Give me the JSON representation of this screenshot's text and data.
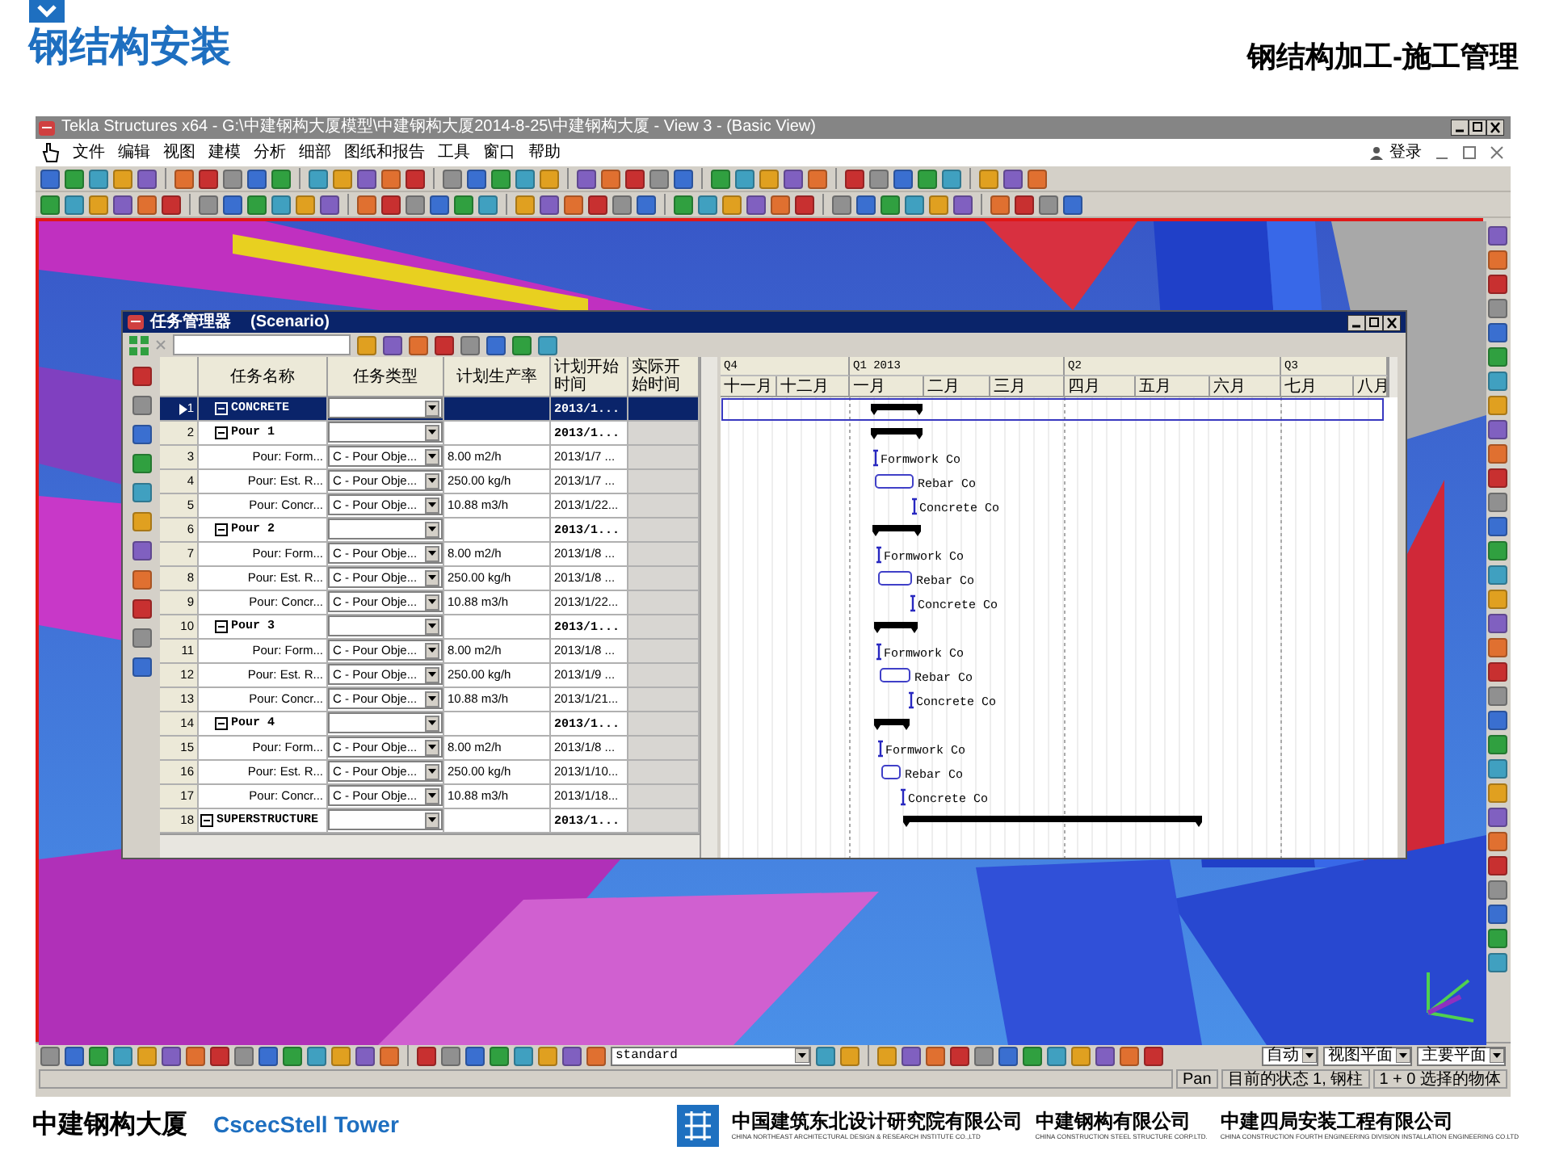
{
  "slide": {
    "title": "钢结构安装",
    "subtitle": "钢结构加工-施工管理"
  },
  "app": {
    "title": "Tekla Structures x64 - G:\\中建钢构大厦模型\\中建钢构大厦2014-8-25\\中建钢构大厦  - View 3 - (Basic View)",
    "menu": [
      "文件",
      "编辑",
      "视图",
      "建模",
      "分析",
      "细部",
      "图纸和报告",
      "工具",
      "窗口",
      "帮助"
    ],
    "login": "登录"
  },
  "task_manager": {
    "title": "任务管理器",
    "subtitle": "(Scenario)",
    "columns": [
      "任务名称",
      "任务类型",
      "计划生产率",
      "计划开始时间",
      "实际开始时间"
    ],
    "rows": [
      {
        "number": "1",
        "kind": "group",
        "name": "CONCRETE",
        "expanded": true,
        "start": "2013/1...",
        "selected": true
      },
      {
        "number": "2",
        "kind": "group",
        "name": "Pour 1",
        "expanded": true,
        "start": "2013/1...",
        "selected": false
      },
      {
        "number": "3",
        "kind": "task",
        "name": "Pour: Form...",
        "type": "C - Pour Obje...",
        "rate": "8.00 m2/h",
        "start": "2013/1/7 ...",
        "gantt_label": "Formwork Co",
        "selected": false
      },
      {
        "number": "4",
        "kind": "task",
        "name": "Pour: Est. R...",
        "type": "C - Pour Obje...",
        "rate": "250.00 kg/h",
        "start": "2013/1/7 ...",
        "gantt_label": "Rebar Co",
        "selected": false
      },
      {
        "number": "5",
        "kind": "task",
        "name": "Pour: Concr...",
        "type": "C - Pour Obje...",
        "rate": "10.88 m3/h",
        "start": "2013/1/22...",
        "gantt_label": "Concrete Co",
        "selected": false
      },
      {
        "number": "6",
        "kind": "group",
        "name": "Pour 2",
        "expanded": true,
        "start": "2013/1...",
        "selected": false
      },
      {
        "number": "7",
        "kind": "task",
        "name": "Pour: Form...",
        "type": "C - Pour Obje...",
        "rate": "8.00 m2/h",
        "start": "2013/1/8 ...",
        "gantt_label": "Formwork Co",
        "selected": false
      },
      {
        "number": "8",
        "kind": "task",
        "name": "Pour: Est. R...",
        "type": "C - Pour Obje...",
        "rate": "250.00 kg/h",
        "start": "2013/1/8 ...",
        "gantt_label": "Rebar Co",
        "selected": false
      },
      {
        "number": "9",
        "kind": "task",
        "name": "Pour: Concr...",
        "type": "C - Pour Obje...",
        "rate": "10.88 m3/h",
        "start": "2013/1/22...",
        "gantt_label": "Concrete Co",
        "selected": false
      },
      {
        "number": "10",
        "kind": "group",
        "name": "Pour 3",
        "expanded": true,
        "start": "2013/1...",
        "selected": false
      },
      {
        "number": "11",
        "kind": "task",
        "name": "Pour: Form...",
        "type": "C - Pour Obje...",
        "rate": "8.00 m2/h",
        "start": "2013/1/8 ...",
        "gantt_label": "Formwork Co",
        "selected": false
      },
      {
        "number": "12",
        "kind": "task",
        "name": "Pour: Est. R...",
        "type": "C - Pour Obje...",
        "rate": "250.00 kg/h",
        "start": "2013/1/9 ...",
        "gantt_label": "Rebar Co",
        "selected": false
      },
      {
        "number": "13",
        "kind": "task",
        "name": "Pour: Concr...",
        "type": "C - Pour Obje...",
        "rate": "10.88 m3/h",
        "start": "2013/1/21...",
        "gantt_label": "Concrete Co",
        "selected": false
      },
      {
        "number": "14",
        "kind": "group",
        "name": "Pour 4",
        "expanded": true,
        "start": "2013/1...",
        "selected": false
      },
      {
        "number": "15",
        "kind": "task",
        "name": "Pour: Form...",
        "type": "C - Pour Obje...",
        "rate": "8.00 m2/h",
        "start": "2013/1/8 ...",
        "gantt_label": "Formwork Co",
        "selected": false
      },
      {
        "number": "16",
        "kind": "task",
        "name": "Pour: Est. R...",
        "type": "C - Pour Obje...",
        "rate": "250.00 kg/h",
        "start": "2013/1/10...",
        "gantt_label": "Rebar Co",
        "selected": false
      },
      {
        "number": "17",
        "kind": "task",
        "name": "Pour: Concr...",
        "type": "C - Pour Obje...",
        "rate": "10.88 m3/h",
        "start": "2013/1/18...",
        "gantt_label": "Concrete Co",
        "selected": false
      },
      {
        "number": "18",
        "kind": "group",
        "name": "SUPERSTRUCTURE",
        "expanded": true,
        "start": "2013/1...",
        "selected": false
      }
    ],
    "gantt": {
      "quarters": [
        "Q4",
        "Q1 2013",
        "Q2",
        "Q3"
      ],
      "months": [
        "十一月",
        "十二月",
        "一月",
        "二月",
        "三月",
        "四月",
        "五月",
        "六月",
        "七月",
        "八月"
      ]
    }
  },
  "bottom_toolbar": {
    "filter": "standard",
    "dropdowns": [
      "自动",
      "视图平面",
      "主要平面"
    ]
  },
  "status_bar": [
    "Pan",
    "目前的状态 1, 钢柱",
    "1 + 0 选择的物体"
  ],
  "footer": {
    "project": "中建钢构大厦",
    "project_en": "CscecStell Tower",
    "companies": [
      {
        "name": "中国建筑东北设计研究院有限公司",
        "name_en": "CHINA NORTHEAST ARCHITECTURAL DESIGN & RESEARCH INSTITUTE CO.,LTD"
      },
      {
        "name": "中建钢构有限公司",
        "name_en": "CHINA CONSTRUCTION STEEL STRUCTURE CORP.LTD."
      },
      {
        "name": "中建四局安装工程有限公司",
        "name_en": "CHINA CONSTRUCTION FOURTH ENGINEERING DIVISION INSTALLATION ENGINEERING CO.LTD"
      }
    ]
  }
}
